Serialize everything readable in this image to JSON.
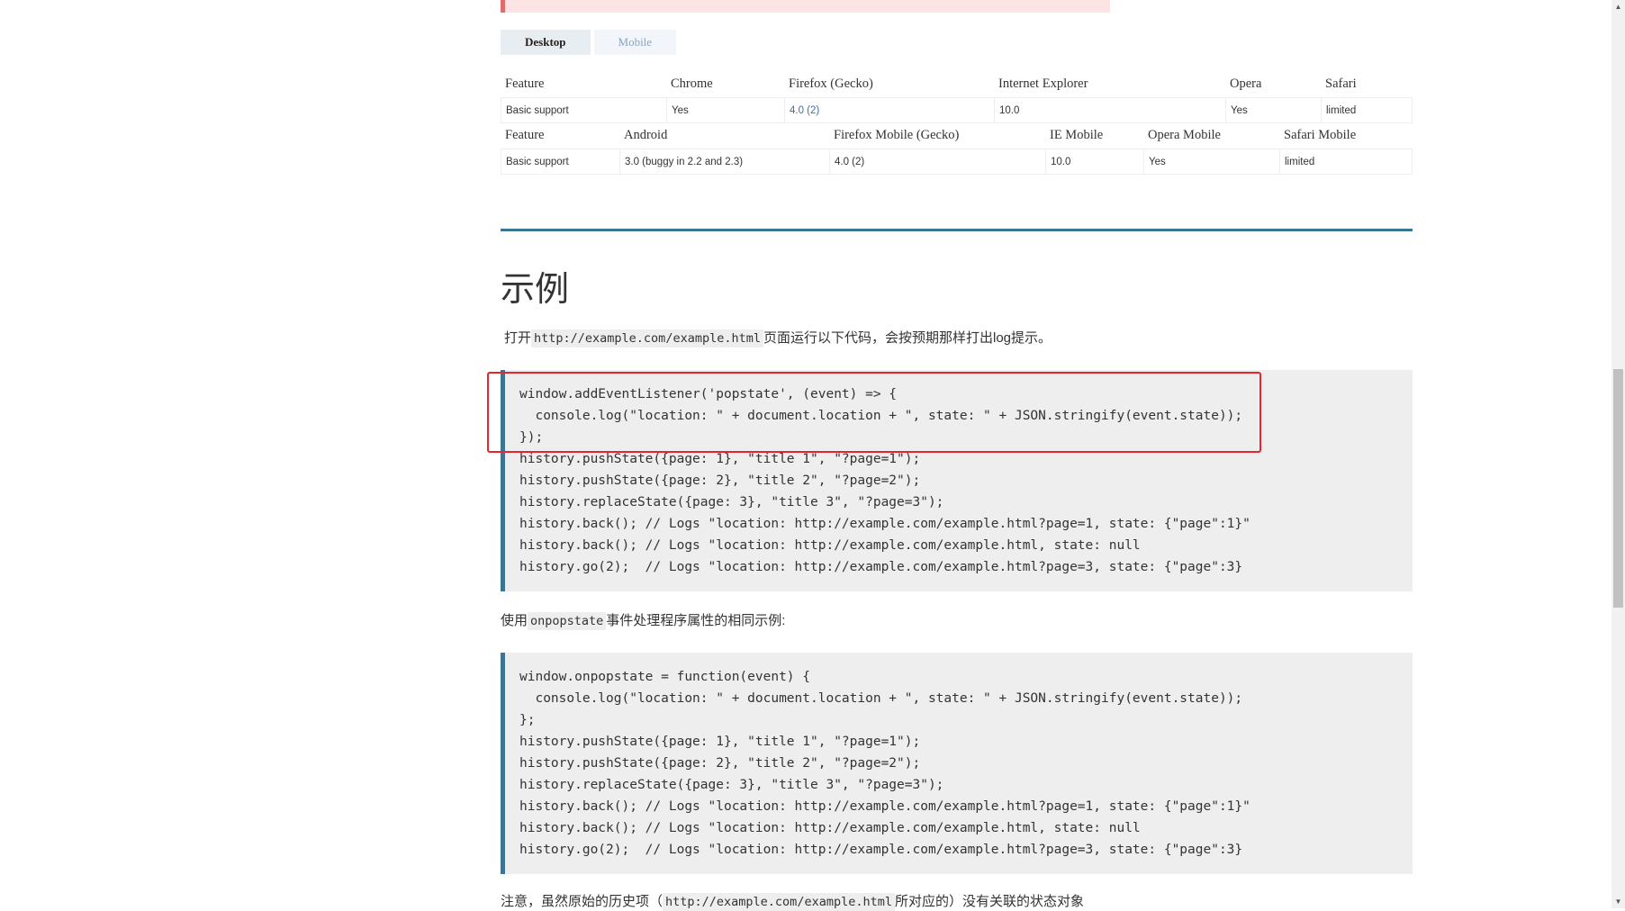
{
  "tabs": [
    {
      "label": "Desktop",
      "active": true
    },
    {
      "label": "Mobile",
      "active": false
    }
  ],
  "desktop_table": {
    "headers": [
      "Feature",
      "Chrome",
      "Firefox (Gecko)",
      "Internet Explorer",
      "Opera",
      "Safari"
    ],
    "row": [
      "Basic support",
      "Yes",
      "4.0 (2)",
      "10.0",
      "Yes",
      "limited"
    ]
  },
  "mobile_table": {
    "headers": [
      "Feature",
      "Android",
      "Firefox Mobile (Gecko)",
      "IE Mobile",
      "Opera Mobile",
      "Safari Mobile"
    ],
    "row": [
      "Basic support",
      "3.0 (buggy in 2.2 and 2.3)",
      "4.0 (2)",
      "10.0",
      "Yes",
      "limited"
    ]
  },
  "section_title": "示例",
  "intro": {
    "prefix": "打开",
    "code": "http://example.com/example.html",
    "middle": "页面运行以下代码，",
    "suffix": "会按预期那样打出log提示。"
  },
  "code_block_1": [
    "window.addEventListener('popstate', (event) => {",
    "  console.log(\"location: \" + document.location + \", state: \" + JSON.stringify(event.state));",
    "});",
    "history.pushState({page: 1}, \"title 1\", \"?page=1\");",
    "history.pushState({page: 2}, \"title 2\", \"?page=2\");",
    "history.replaceState({page: 3}, \"title 3\", \"?page=3\");",
    "history.back(); // Logs \"location: http://example.com/example.html?page=1, state: {\"page\":1}\"",
    "history.back(); // Logs \"location: http://example.com/example.html, state: null",
    "history.go(2);  // Logs \"location: http://example.com/example.html?page=3, state: {\"page\":3}"
  ],
  "onpopstate_text": {
    "prefix": "使用",
    "code": "onpopstate",
    "suffix": "事件处理程序属性的相同示例:"
  },
  "code_block_2": [
    "window.onpopstate = function(event) {",
    "  console.log(\"location: \" + document.location + \", state: \" + JSON.stringify(event.state));",
    "};",
    "history.pushState({page: 1}, \"title 1\", \"?page=1\");",
    "history.pushState({page: 2}, \"title 2\", \"?page=2\");",
    "history.replaceState({page: 3}, \"title 3\", \"?page=3\");",
    "history.back(); // Logs \"location: http://example.com/example.html?page=1, state: {\"page\":1}\"",
    "history.back(); // Logs \"location: http://example.com/example.html, state: null",
    "history.go(2);  // Logs \"location: http://example.com/example.html?page=3, state: {\"page\":3}"
  ],
  "note": {
    "prefix": "注意，虽然原始的历史项（",
    "code": "http://example.com/example.html",
    "suffix": "所对应的）没有关联的状态对象"
  },
  "colors": {
    "accent": "#3d7393",
    "highlight": "#e8242c",
    "code_bg": "#eeeeee",
    "link": "#3d6fa8"
  }
}
